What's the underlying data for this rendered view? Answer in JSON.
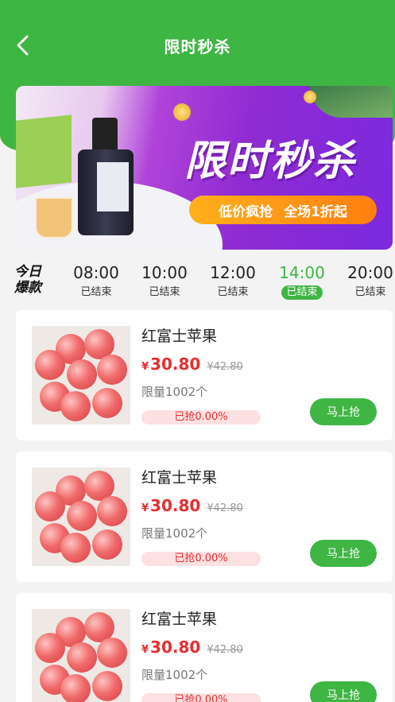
{
  "header": {
    "title": "限时秒杀"
  },
  "banner": {
    "headline": "限时秒杀",
    "tag_left": "低价疯抢",
    "tag_right": "全场1折起"
  },
  "timebar": {
    "today_line1": "今日",
    "today_line2": "爆款",
    "slots": [
      {
        "time": "08:00",
        "state": "已结束",
        "active": false
      },
      {
        "time": "10:00",
        "state": "已结束",
        "active": false
      },
      {
        "time": "12:00",
        "state": "已结束",
        "active": false
      },
      {
        "time": "14:00",
        "state": "已结束",
        "active": true
      },
      {
        "time": "20:00",
        "state": "已结束",
        "active": false
      }
    ]
  },
  "products": [
    {
      "name": "红富士苹果",
      "currency": "¥",
      "price": "30.80",
      "old_price": "¥42.80",
      "limit": "限量1002个",
      "progress": "已抢0.00%",
      "buy": "马上抢"
    },
    {
      "name": "红富士苹果",
      "currency": "¥",
      "price": "30.80",
      "old_price": "¥42.80",
      "limit": "限量1002个",
      "progress": "已抢0.00%",
      "buy": "马上抢"
    },
    {
      "name": "红富士苹果",
      "currency": "¥",
      "price": "30.80",
      "old_price": "¥42.80",
      "limit": "限量1002个",
      "progress": "已抢0.00%",
      "buy": "马上抢"
    }
  ],
  "colors": {
    "primary": "#3fb544",
    "price": "#e62e2e",
    "tag": "#ff9a15"
  },
  "icons": {
    "back": "chevron-left-icon"
  }
}
